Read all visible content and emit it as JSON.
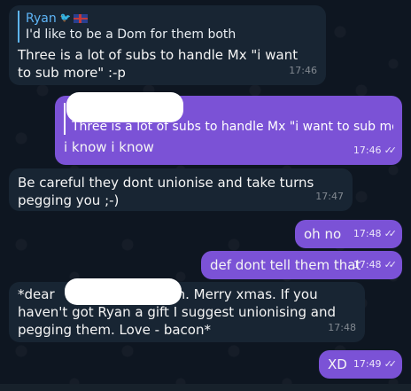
{
  "messages": [
    {
      "sender_side": "incoming",
      "reply": {
        "name": "Ryan",
        "text": "I'd like to be a Dom for them both"
      },
      "text": "Three is a lot of subs to handle Mx \"i want to sub more\" :-p",
      "time": "17:46"
    },
    {
      "sender_side": "outgoing",
      "reply": {
        "name": "",
        "text": "Three is a lot of subs to handle Mx \"i want to sub more\" :-p"
      },
      "text": "i know i know",
      "time": "17:46",
      "status": "read"
    },
    {
      "sender_side": "incoming",
      "text": "Be careful they dont unionise and take turns pegging you ;-)",
      "time": "17:47"
    },
    {
      "sender_side": "outgoing",
      "text": "oh no",
      "time": "17:48",
      "status": "read"
    },
    {
      "sender_side": "outgoing",
      "text": "def dont tell them that",
      "time": "17:48",
      "status": "read"
    },
    {
      "sender_side": "incoming",
      "text_start": "*dear",
      "text_rest": "n. Merry xmas. If you haven't got Ryan a gift I suggest unionising and pegging them. Love - bacon*",
      "time": "17:48"
    },
    {
      "sender_side": "outgoing",
      "text": "XD",
      "time": "17:49",
      "status": "read"
    }
  ],
  "checks_glyph": "✓✓",
  "colors": {
    "background": "#0e1621",
    "incoming_bubble": "#182533",
    "outgoing_bubble": "#7b52d6",
    "reply_name": "#5eb5f7"
  }
}
